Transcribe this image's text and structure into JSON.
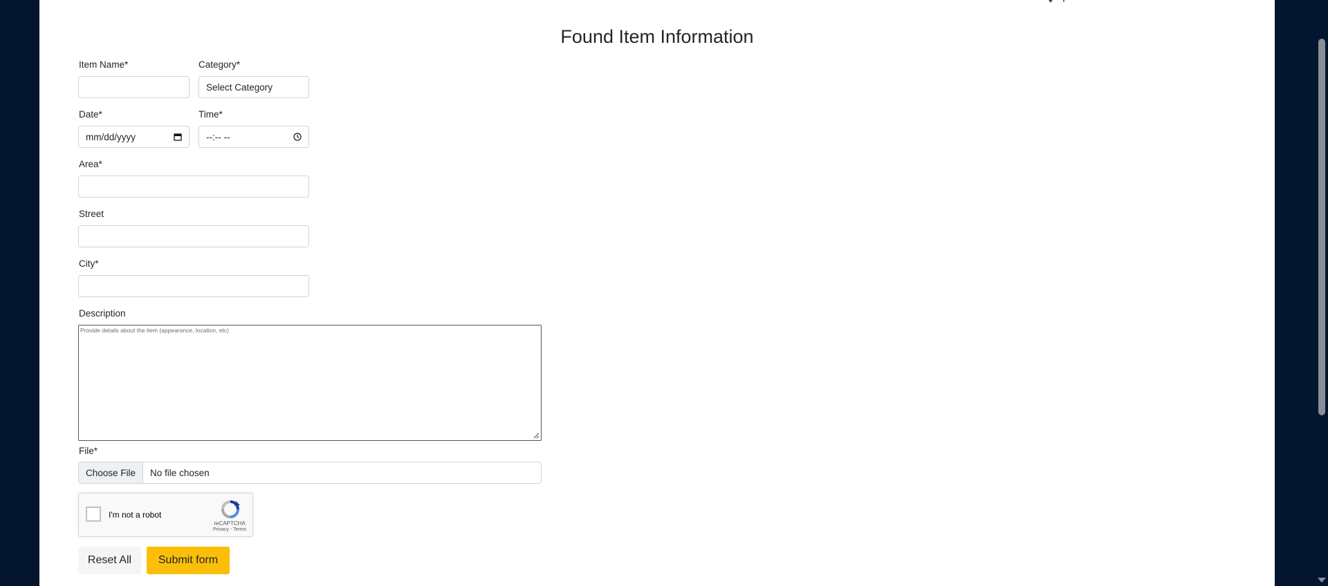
{
  "form": {
    "title": "Found Item Information",
    "item_name": {
      "label": "Item Name*",
      "value": ""
    },
    "category": {
      "label": "Category*",
      "selected": "Select Category"
    },
    "date": {
      "label": "Date*",
      "placeholder": "mm/dd/yyyy"
    },
    "time": {
      "label": "Time*",
      "placeholder": "--:-- --"
    },
    "area": {
      "label": "Area*",
      "value": ""
    },
    "street": {
      "label": "Street",
      "value": ""
    },
    "city": {
      "label": "City*",
      "value": ""
    },
    "description": {
      "label": "Description",
      "placeholder": "Provide details about the  item (appearance, location, etc)"
    },
    "file": {
      "label": "File*",
      "button": "Choose File",
      "status": "No file chosen"
    },
    "captcha": {
      "text": "I'm not a robot",
      "brand": "reCAPTCHA",
      "links": "Privacy - Terms"
    },
    "buttons": {
      "reset": "Reset All",
      "submit": "Submit form"
    }
  },
  "colors": {
    "background": "#04162f",
    "submit": "#fbbf09",
    "reset": "#f4f5f6"
  }
}
